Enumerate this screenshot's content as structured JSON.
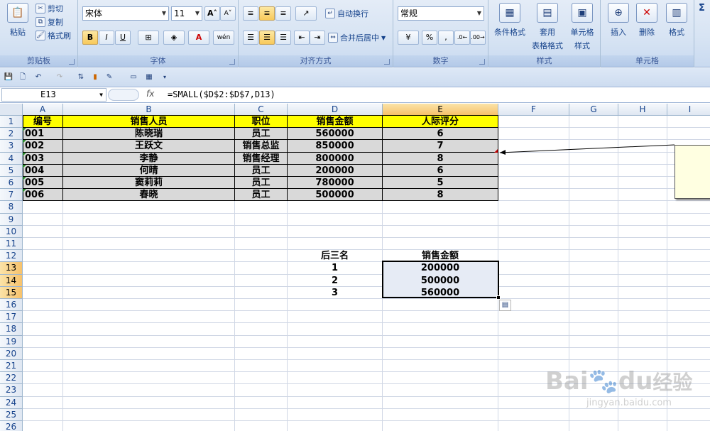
{
  "ribbon": {
    "clipboard": {
      "paste": "粘贴",
      "cut": "剪切",
      "copy": "复制",
      "format_painter": "格式刷",
      "label": "剪贴板"
    },
    "font": {
      "name": "宋体",
      "size": "11",
      "bold": "B",
      "italic": "I",
      "underline": "U",
      "grow": "A",
      "shrink": "A",
      "font_color": "A",
      "phonetic": "wén",
      "label": "字体"
    },
    "alignment": {
      "wrap": "自动换行",
      "merge": "合并后居中",
      "label": "对齐方式"
    },
    "number": {
      "format": "常规",
      "percent": "%",
      "comma": ",",
      "label": "数字"
    },
    "styles": {
      "conditional": "条件格式",
      "table_format_1": "套用",
      "table_format_2": "表格格式",
      "cell_styles_1": "单元格",
      "cell_styles_2": "样式",
      "label": "样式"
    },
    "cells": {
      "insert": "插入",
      "delete": "删除",
      "format": "格式",
      "label": "单元格"
    },
    "sigma": "Σ"
  },
  "formula_bar": {
    "name_box": "E13",
    "fx": "fx",
    "formula": "=SMALL($D$2:$D$7,D13)"
  },
  "columns": [
    "A",
    "B",
    "C",
    "D",
    "E",
    "F",
    "G",
    "H",
    "I"
  ],
  "selected_column": "E",
  "rows": [
    "1",
    "2",
    "3",
    "4",
    "5",
    "6",
    "7",
    "8",
    "9",
    "10",
    "11",
    "12",
    "13",
    "14",
    "15",
    "16",
    "17",
    "18",
    "19",
    "20",
    "21",
    "22",
    "23",
    "24",
    "25",
    "26"
  ],
  "selected_rows": [
    "13",
    "14",
    "15"
  ],
  "table": {
    "header": [
      "编号",
      "销售人员",
      "职位",
      "销售金额",
      "人际评分"
    ],
    "data": [
      [
        "001",
        "陈晓瑞",
        "员工",
        "560000",
        "6"
      ],
      [
        "002",
        "王跃文",
        "销售总监",
        "850000",
        "7"
      ],
      [
        "003",
        "李静",
        "销售经理",
        "800000",
        "8"
      ],
      [
        "004",
        "何晴",
        "员工",
        "200000",
        "6"
      ],
      [
        "005",
        "窦莉莉",
        "员工",
        "780000",
        "5"
      ],
      [
        "006",
        "春晓",
        "员工",
        "500000",
        "8"
      ]
    ]
  },
  "summary": {
    "label": "后三名",
    "col_header": "销售金额",
    "ranks": [
      "1",
      "2",
      "3"
    ],
    "values": [
      "200000",
      "500000",
      "560000"
    ]
  },
  "watermark": {
    "brand": "Bai",
    "brand2": "du",
    "text": "经验",
    "url": "jingyan.baidu.com"
  },
  "colors": {
    "header_fill": "#ffff00",
    "data_fill": "#d9d9d9",
    "selection_fill": "#e6ebf5"
  }
}
